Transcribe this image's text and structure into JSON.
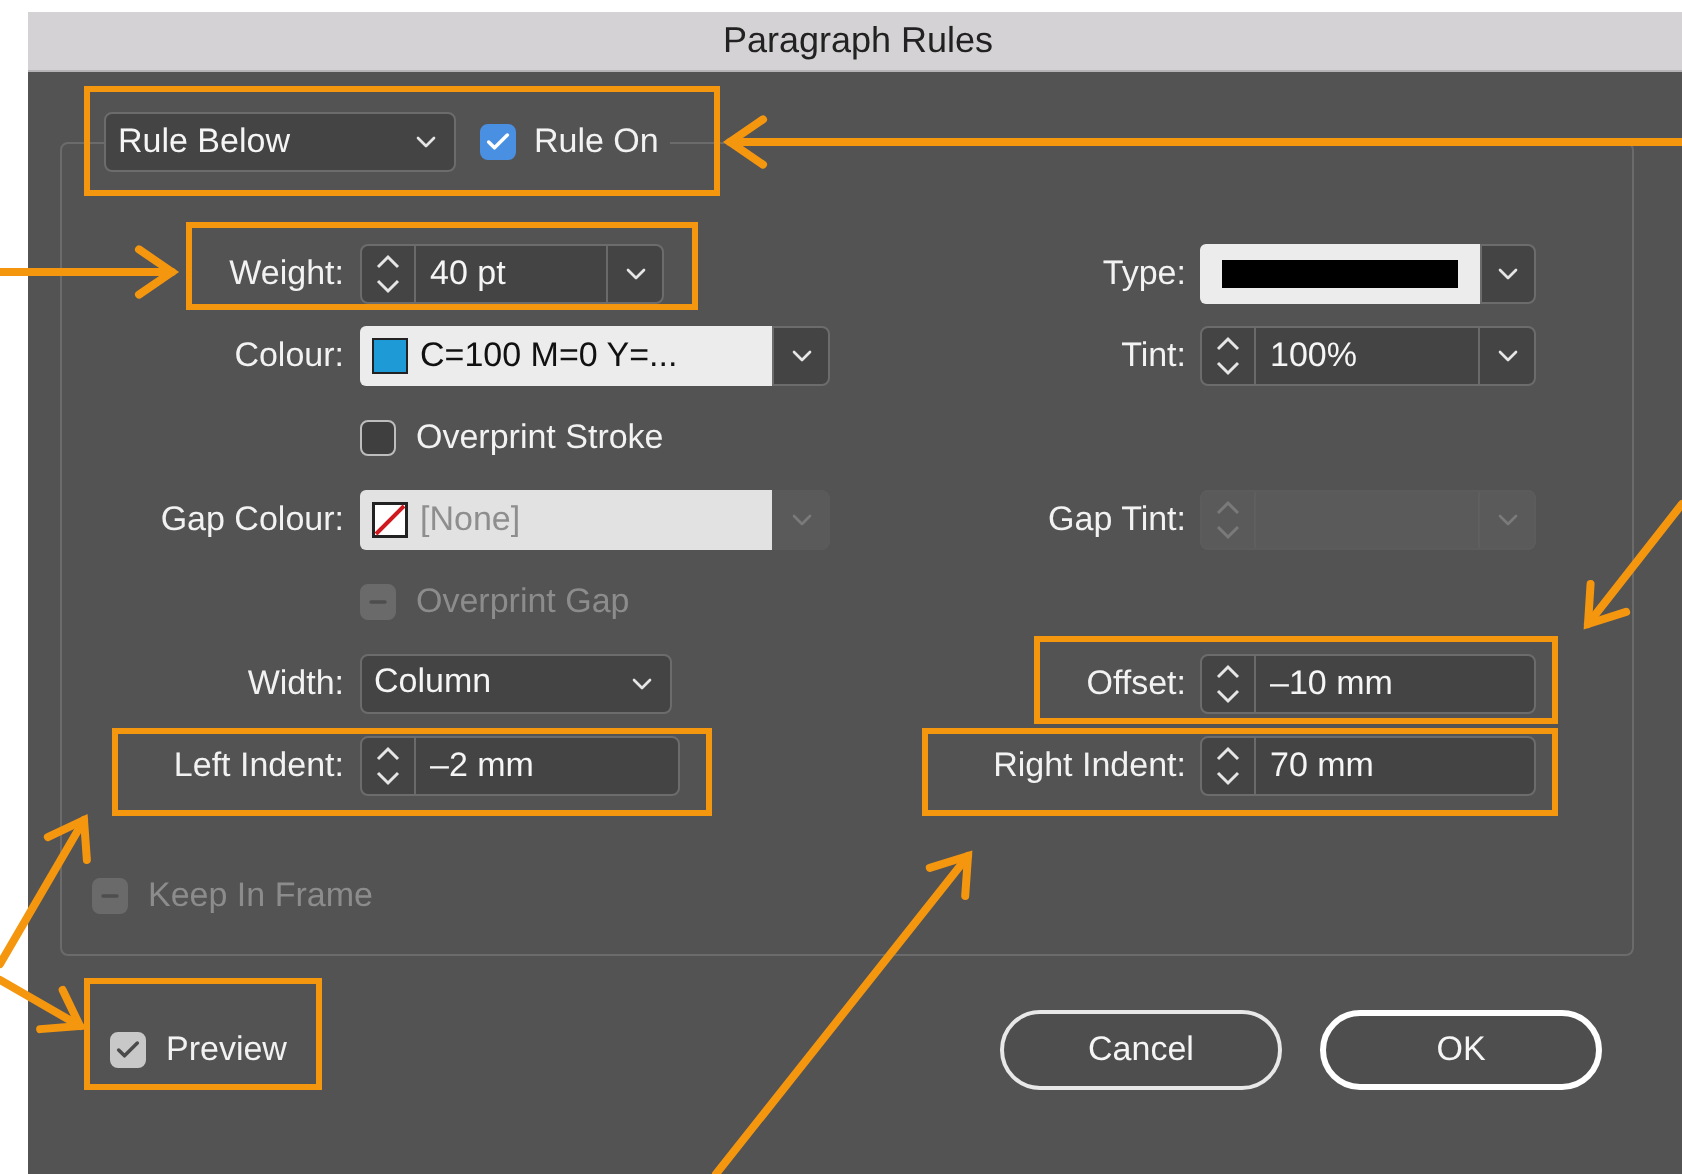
{
  "window": {
    "title": "Paragraph Rules"
  },
  "rule_select": {
    "value": "Rule Below"
  },
  "rule_on": {
    "label": "Rule On",
    "checked": true,
    "color": "#4a90e2"
  },
  "rows": [
    {
      "left": {
        "kind": "spin-combo",
        "label": "Weight:",
        "value": "40 pt",
        "disabled": false
      },
      "right": {
        "kind": "stroke-type",
        "label": "Type:",
        "disabled": false
      }
    },
    {
      "left": {
        "kind": "swatch-combo",
        "label": "Colour:",
        "value": "C=100 M=0 Y=...",
        "color": "#1e9ad6",
        "disabled": false
      },
      "right": {
        "kind": "spin-combo",
        "label": "Tint:",
        "value": "100%",
        "disabled": false
      }
    },
    {
      "left": {
        "kind": "checkbox",
        "text": "Overprint Stroke",
        "checked": false,
        "mixed": false,
        "disabled": false
      }
    },
    {
      "left": {
        "kind": "swatch-combo",
        "label": "Gap Colour:",
        "value": "[None]",
        "no_color": true,
        "disabled": true
      },
      "right": {
        "kind": "spin-combo",
        "label": "Gap Tint:",
        "disabled": true
      }
    },
    {
      "left": {
        "kind": "checkbox",
        "text": "Overprint Gap",
        "checked": false,
        "mixed": true,
        "disabled": true
      }
    },
    {
      "left": {
        "kind": "select",
        "label": "Width:",
        "value": "Column",
        "disabled": false
      },
      "right": {
        "kind": "spinner",
        "label": "Offset:",
        "value": "–10 mm",
        "disabled": false
      }
    },
    {
      "left": {
        "kind": "spinner",
        "label": "Left Indent:",
        "value": "–2 mm",
        "disabled": false
      },
      "right": {
        "kind": "spinner",
        "label": "Right Indent:",
        "value": "70 mm",
        "disabled": false
      }
    }
  ],
  "keep_in_frame": {
    "text": "Keep In Frame",
    "checked": false,
    "mixed": true,
    "disabled": true
  },
  "preview": {
    "text": "Preview",
    "checked": true,
    "color": "#c8c8c8"
  },
  "buttons": [
    {
      "label": "Cancel",
      "default": false
    },
    {
      "label": "OK",
      "default": true
    }
  ]
}
